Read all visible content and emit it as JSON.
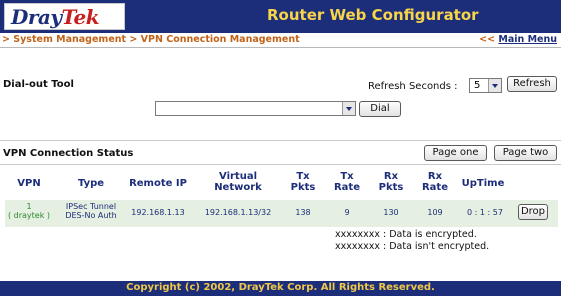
{
  "brand": {
    "logo_part1": "Dray",
    "logo_part2": "Tek",
    "title": "Router Web Configurator"
  },
  "breadcrumb": {
    "text": "> System Management > VPN Connection Management",
    "menu_prefix": "<<",
    "main_menu": "Main Menu"
  },
  "dialout": {
    "label": "Dial-out Tool",
    "selected": "",
    "dial_button": "Dial"
  },
  "refresh": {
    "label": "Refresh Seconds :",
    "value": "5",
    "button": "Refresh"
  },
  "status": {
    "label": "VPN Connection Status",
    "page_one": "Page one",
    "page_two": "Page two",
    "headers": {
      "vpn": "VPN",
      "type": "Type",
      "remote_ip": "Remote IP",
      "virtual_network_1": "Virtual",
      "virtual_network_2": "Network",
      "tx_pkts_1": "Tx",
      "tx_pkts_2": "Pkts",
      "tx_rate_1": "Tx",
      "tx_rate_2": "Rate",
      "rx_pkts_1": "Rx",
      "rx_pkts_2": "Pkts",
      "rx_rate_1": "Rx",
      "rx_rate_2": "Rate",
      "uptime": "UpTime"
    },
    "row": {
      "vpn_index": "1",
      "vpn_name": "( draytek )",
      "type_1": "IPSec Tunnel",
      "type_2": "DES-No Auth",
      "remote_ip": "192.168.1.13",
      "virtual_network": "192.168.1.13/32",
      "tx_pkts": "138",
      "tx_rate": "9",
      "rx_pkts": "130",
      "rx_rate": "109",
      "uptime": "0 : 1 : 57",
      "drop_button": "Drop"
    },
    "legend": {
      "encrypted": "xxxxxxxx : Data is encrypted.",
      "not_encrypted": "xxxxxxxx : Data isn't encrypted."
    },
    "colors": {
      "encrypted": "#2e8a2e",
      "not_encrypted": "#111111"
    }
  },
  "footer": {
    "copyright": "Copyright (c) 2002, DrayTek Corp. All Rights Reserved."
  },
  "theme": {
    "navy": "#1c2e7a",
    "gold": "#f7d448",
    "orange": "#c26318",
    "row_bg": "#e5efe2"
  }
}
